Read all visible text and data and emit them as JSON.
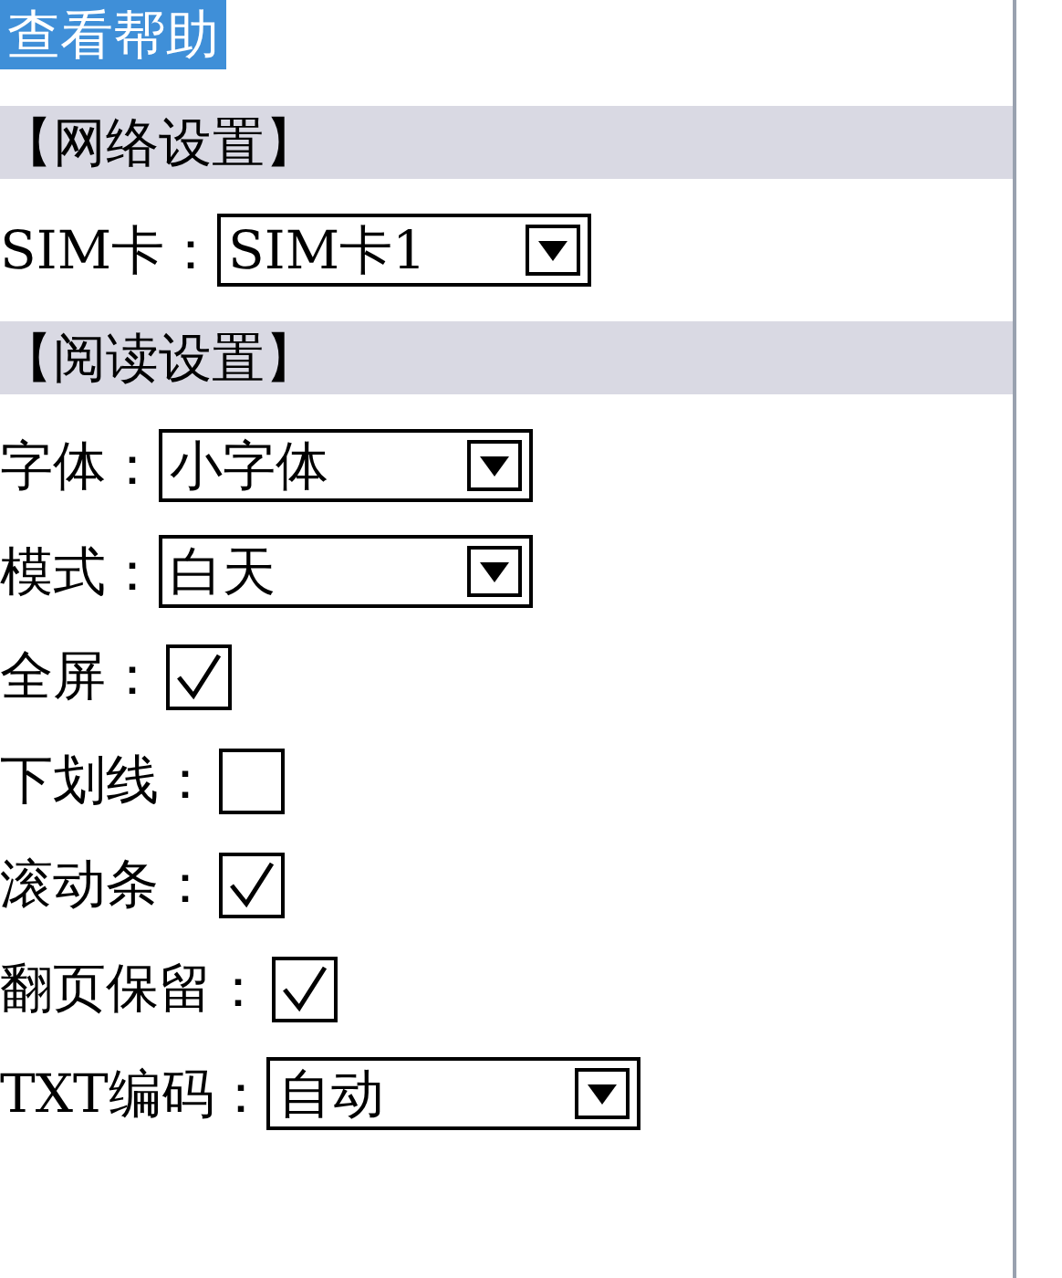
{
  "help_link": "查看帮助",
  "sections": [
    {
      "title": "【网络设置】",
      "fields": [
        {
          "kind": "select",
          "label": "SIM卡：",
          "value": "SIM卡1"
        }
      ]
    },
    {
      "title": "【阅读设置】",
      "fields": [
        {
          "kind": "select",
          "label": "字体：",
          "value": "小字体"
        },
        {
          "kind": "select",
          "label": "模式：",
          "value": "白天"
        },
        {
          "kind": "checkbox",
          "label": "全屏：",
          "checked": true
        },
        {
          "kind": "checkbox",
          "label": "下划线：",
          "checked": false
        },
        {
          "kind": "checkbox",
          "label": "滚动条：",
          "checked": true
        },
        {
          "kind": "checkbox",
          "label": "翻页保留：",
          "checked": true
        },
        {
          "kind": "select",
          "label": "TXT编码：",
          "value": "自动"
        }
      ]
    }
  ]
}
